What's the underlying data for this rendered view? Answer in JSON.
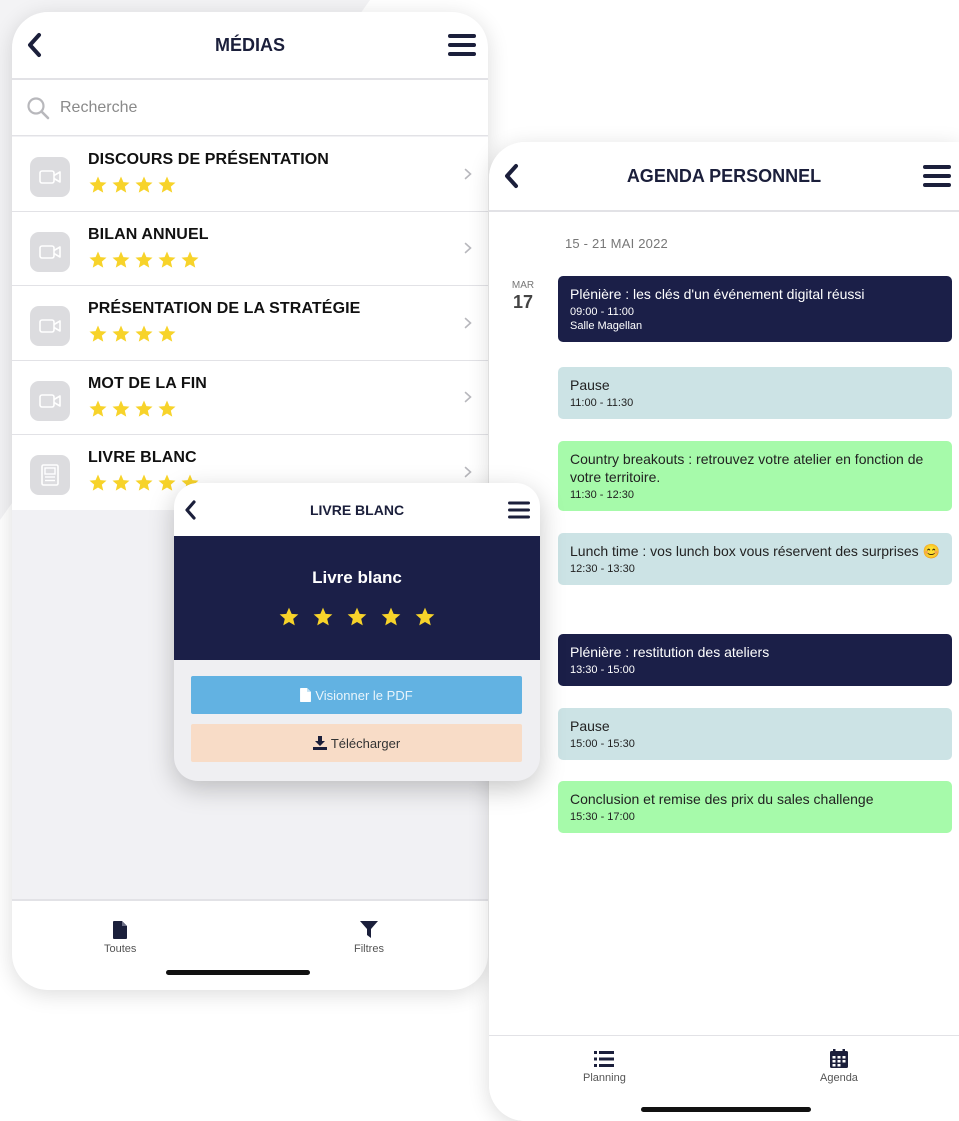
{
  "medias": {
    "title": "MÉDIAS",
    "search_placeholder": "Recherche",
    "items": [
      {
        "title": "DISCOURS DE PRÉSENTATION",
        "rating": 4,
        "icon": "video-icon"
      },
      {
        "title": "BILAN ANNUEL",
        "rating": 5,
        "icon": "video-icon"
      },
      {
        "title": "PRÉSENTATION DE LA STRATÉGIE",
        "rating": 4,
        "icon": "video-icon"
      },
      {
        "title": "MOT DE LA FIN",
        "rating": 4,
        "icon": "video-icon"
      },
      {
        "title": "LIVRE BLANC",
        "rating": 5,
        "icon": "document-icon"
      }
    ],
    "tabs": [
      {
        "label": "Toutes",
        "icon": "file-icon"
      },
      {
        "label": "Filtres",
        "icon": "filter-icon"
      }
    ]
  },
  "livre_blanc": {
    "nav_title": "LIVRE BLANC",
    "title": "Livre blanc",
    "rating": 5,
    "view_pdf_label": "Visionner le PDF",
    "download_label": "Télécharger"
  },
  "agenda": {
    "title": "AGENDA PERSONNEL",
    "week_range": "15 - 21 MAI 2022",
    "day_of_week": "MAR",
    "day_number": "17",
    "events": [
      {
        "title": "Plénière : les clés d'un événement digital réussi",
        "time": "09:00 - 11:00",
        "room": "Salle Magellan",
        "style": "dark"
      },
      {
        "title": "Pause",
        "time": "11:00 - 11:30",
        "style": "light"
      },
      {
        "title": "Country breakouts : retrouvez votre atelier en fonction de votre territoire.",
        "time": "11:30 - 12:30",
        "style": "green"
      },
      {
        "title": "Lunch time : vos lunch box vous réservent des surprises 😊",
        "time": "12:30 - 13:30",
        "style": "light"
      },
      {
        "title": "Plénière : restitution des ateliers",
        "time": "13:30 - 15:00",
        "style": "dark"
      },
      {
        "title": "Pause",
        "time": "15:00 - 15:30",
        "style": "light"
      },
      {
        "title": "Conclusion et remise des prix du sales challenge",
        "time": "15:30 - 17:00",
        "style": "green"
      }
    ],
    "tabs": [
      {
        "label": "Planning",
        "icon": "list-icon"
      },
      {
        "label": "Agenda",
        "icon": "calendar-icon"
      }
    ]
  },
  "colors": {
    "navy": "#1b1f48",
    "star": "#f7d32a",
    "pause": "#cce3e5",
    "green": "#a6faaa",
    "pdf_button": "#62b2e2",
    "download_button": "#f8dcc7"
  }
}
